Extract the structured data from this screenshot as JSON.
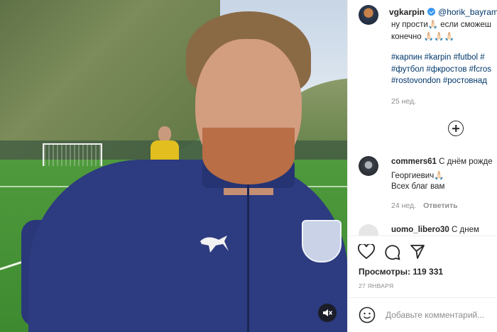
{
  "post": {
    "author": "vgkarpin",
    "mention": "@horik_bayram",
    "caption_lines": [
      "ну прости🙏🏻 если сможеш",
      "конечно 🙏🏻🙏🏻🙏🏻"
    ],
    "hashtags": [
      "#карпин #karpin #futbol #",
      "#футбол #фкростов #fcros",
      "#rostovondon #ростовнад"
    ],
    "time_ago": "25 нед."
  },
  "comments": [
    {
      "username": "commers61",
      "text_lines": [
        "С днём рожде",
        "Георгиевич🙏🏻",
        "Всех благ вам"
      ],
      "time_ago": "24 нед.",
      "reply_label": "Ответить"
    },
    {
      "username": "uomo_libero30",
      "text_lines": [
        "С днем"
      ]
    }
  ],
  "stats": {
    "views_label": "Просмотры:",
    "views_count": "119 331",
    "date": "27 ЯНВАРЯ"
  },
  "composer": {
    "placeholder": "Добавьте комментарий..."
  },
  "icons": {
    "like": "heart-icon",
    "comment": "comment-icon",
    "share": "share-icon",
    "emoji": "emoji-icon",
    "mute": "sound-off-icon",
    "more": "plus-circle-icon"
  },
  "colors": {
    "link": "#00376b",
    "muted": "#8e8e8e",
    "verified": "#3897f0"
  }
}
